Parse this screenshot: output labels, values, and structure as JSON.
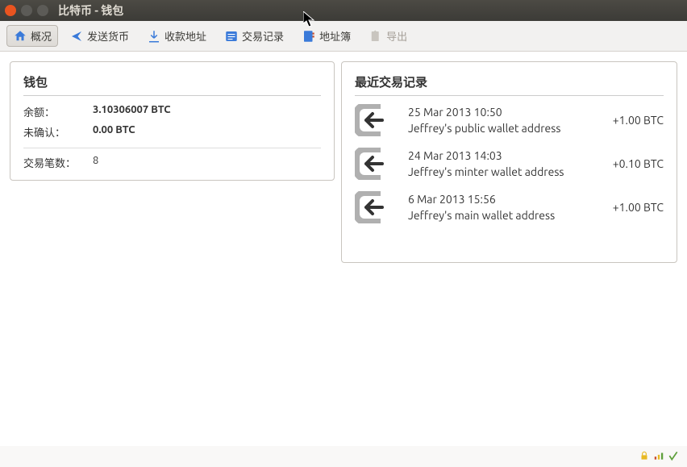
{
  "window": {
    "title": "比特币 - 钱包"
  },
  "toolbar": {
    "overview": "概况",
    "send": "发送货币",
    "receive": "收款地址",
    "transactions": "交易记录",
    "addressbook": "地址簿",
    "export": "导出"
  },
  "wallet": {
    "title": "钱包",
    "balance_label": "余额：",
    "balance_value": "3.10306007 BTC",
    "unconfirmed_label": "未确认：",
    "unconfirmed_value": "0.00 BTC",
    "tx_count_label": "交易笔数：",
    "tx_count_value": "8"
  },
  "recent": {
    "title": "最近交易记录",
    "items": [
      {
        "date": "25 Mar 2013 10:50",
        "address": "Jeffrey's public wallet address",
        "amount": "+1.00 BTC"
      },
      {
        "date": "24 Mar 2013 14:03",
        "address": "Jeffrey's minter wallet address",
        "amount": "+0.10 BTC"
      },
      {
        "date": "6 Mar 2013 15:56",
        "address": "Jeffrey's main wallet address",
        "amount": "+1.00 BTC"
      }
    ]
  }
}
